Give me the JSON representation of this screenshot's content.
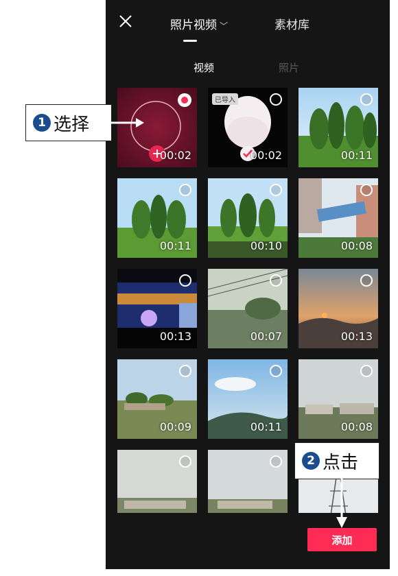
{
  "header": {
    "close_icon": "close-icon",
    "tab_main": "照片视频",
    "tab_library": "素材库"
  },
  "subtabs": {
    "video": "视频",
    "photo": "照片"
  },
  "grid": {
    "items": [
      {
        "duration": "00:02",
        "state": "selected-red"
      },
      {
        "duration": "00:02",
        "badge": "已导入",
        "state": "imported"
      },
      {
        "duration": "00:11"
      },
      {
        "duration": "00:11"
      },
      {
        "duration": "00:10"
      },
      {
        "duration": "00:08"
      },
      {
        "duration": "00:13"
      },
      {
        "duration": "00:07"
      },
      {
        "duration": "00:13"
      },
      {
        "duration": "00:09"
      },
      {
        "duration": "00:11"
      },
      {
        "duration": "00:08"
      },
      {
        "duration": ""
      },
      {
        "duration": ""
      },
      {
        "duration": ""
      }
    ]
  },
  "footer": {
    "add_label": "添加"
  },
  "annotations": {
    "step1": {
      "number": "1",
      "text": "选择"
    },
    "step2": {
      "number": "2",
      "text": "点击"
    }
  },
  "colors": {
    "accent": "#fe2c55",
    "annotation_badge": "#1b4c8f",
    "background": "#151515"
  }
}
